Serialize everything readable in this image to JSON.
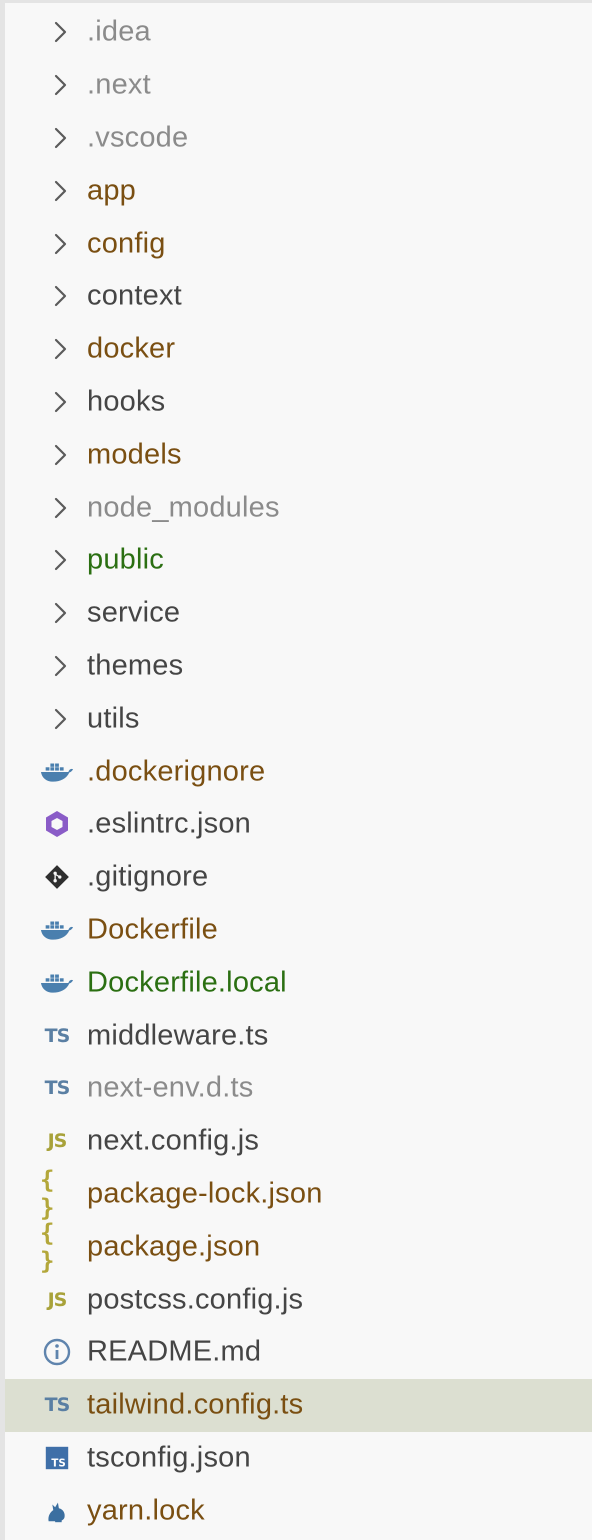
{
  "explorer": {
    "items": [
      {
        "label": ".idea",
        "kind": "folder",
        "color": "dim"
      },
      {
        "label": ".next",
        "kind": "folder",
        "color": "dim"
      },
      {
        "label": ".vscode",
        "kind": "folder",
        "color": "dim"
      },
      {
        "label": "app",
        "kind": "folder",
        "color": "modified"
      },
      {
        "label": "config",
        "kind": "folder",
        "color": "modified"
      },
      {
        "label": "context",
        "kind": "folder",
        "color": "normal"
      },
      {
        "label": "docker",
        "kind": "folder",
        "color": "modified"
      },
      {
        "label": "hooks",
        "kind": "folder",
        "color": "normal"
      },
      {
        "label": "models",
        "kind": "folder",
        "color": "modified"
      },
      {
        "label": "node_modules",
        "kind": "folder",
        "color": "dim"
      },
      {
        "label": "public",
        "kind": "folder",
        "color": "new"
      },
      {
        "label": "service",
        "kind": "folder",
        "color": "normal"
      },
      {
        "label": "themes",
        "kind": "folder",
        "color": "normal"
      },
      {
        "label": "utils",
        "kind": "folder",
        "color": "normal"
      },
      {
        "label": ".dockerignore",
        "kind": "file",
        "icon": "docker-icon",
        "color": "modified"
      },
      {
        "label": ".eslintrc.json",
        "kind": "file",
        "icon": "eslint-icon",
        "color": "normal"
      },
      {
        "label": ".gitignore",
        "kind": "file",
        "icon": "git-icon",
        "color": "normal"
      },
      {
        "label": "Dockerfile",
        "kind": "file",
        "icon": "docker-icon",
        "color": "modified"
      },
      {
        "label": "Dockerfile.local",
        "kind": "file",
        "icon": "docker-icon",
        "color": "new"
      },
      {
        "label": "middleware.ts",
        "kind": "file",
        "icon": "typescript-icon",
        "color": "normal"
      },
      {
        "label": "next-env.d.ts",
        "kind": "file",
        "icon": "typescript-icon",
        "color": "dim"
      },
      {
        "label": "next.config.js",
        "kind": "file",
        "icon": "javascript-icon",
        "color": "normal"
      },
      {
        "label": "package-lock.json",
        "kind": "file",
        "icon": "json-icon",
        "color": "modified"
      },
      {
        "label": "package.json",
        "kind": "file",
        "icon": "json-icon",
        "color": "modified"
      },
      {
        "label": "postcss.config.js",
        "kind": "file",
        "icon": "javascript-icon",
        "color": "normal"
      },
      {
        "label": "README.md",
        "kind": "file",
        "icon": "info-icon",
        "color": "normal"
      },
      {
        "label": "tailwind.config.ts",
        "kind": "file",
        "icon": "typescript-icon",
        "color": "modified",
        "selected": true
      },
      {
        "label": "tsconfig.json",
        "kind": "file",
        "icon": "tsconfig-icon",
        "color": "normal"
      },
      {
        "label": "yarn.lock",
        "kind": "file",
        "icon": "yarn-icon",
        "color": "modified"
      }
    ],
    "icon_glyphs": {
      "ts": "TS",
      "js": "JS",
      "json": "{ }"
    },
    "colors": {
      "dim": "#8b8b8b",
      "modified": "#7a4f12",
      "normal": "#454545",
      "new": "#2b6f12",
      "selected_bg": "#dcdfd1"
    }
  }
}
